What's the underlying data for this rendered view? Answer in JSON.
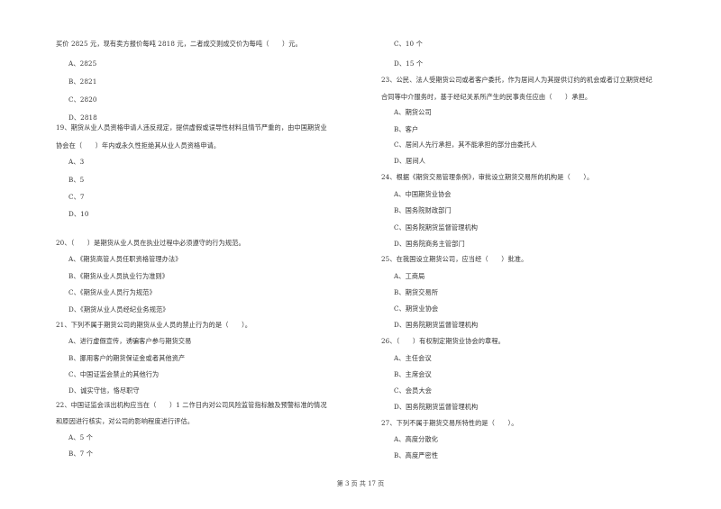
{
  "page": {
    "footer": "第 3 页 共 17 页"
  },
  "left": {
    "q18": {
      "stem_cont": "买价 2825 元，现有卖方报价每吨 2818 元，二者成交则成交价为每吨（　　）元。",
      "options": [
        "A、2825",
        "B、2821",
        "C、2820",
        "D、2818"
      ]
    },
    "q19": {
      "stem_line1": "19、期货从业人员资格申请人违反规定，提供虚假或误导性材料且情节严重的，由中国期货业",
      "stem_line2": "协会在（　　）年内或永久性拒绝其从业人员资格申请。",
      "options": [
        "A、3",
        "B、5",
        "C、7",
        "D、10"
      ]
    },
    "q20": {
      "stem": "20、（　　）是期货从业人员在执业过程中必须遵守的行为规范。",
      "options": [
        "A、《期货高管人员任职资格管理办法》",
        "B、《期货从业人员执业行为准则》",
        "C、《期货从业人员行为规范》",
        "D、《期货从业人员经纪业务规范》"
      ]
    },
    "q21": {
      "stem": "21、下列不属于期货公司的期货从业人员的禁止行为的是（　　）。",
      "options": [
        "A、进行虚假宣传，诱骗客户参与期货交易",
        "B、挪用客户的期货保证金或者其他资产",
        "C、中国证监会禁止的其他行为",
        "D、诚实守信，恪尽职守"
      ]
    },
    "q22": {
      "stem_line1": "22、中国证监会派出机构应当在（　　）1 二作日内对公司风险监管指标触及预警标准的情况",
      "stem_line2": "和原因进行核实，对公司的影响程度进行评估。",
      "options": [
        "A、5 个",
        "B、7 个"
      ]
    }
  },
  "right": {
    "q22_cont": {
      "options": [
        "C、10 个",
        "D、15 个"
      ]
    },
    "q23": {
      "stem_line1": "23、公民、法人受期货公司或者客户委托，作为居间人为其提供订约的机会或者订立期货经纪",
      "stem_line2": "合同等中介服务时，基于经纪关系所产生的民事责任应由（　　）承担。",
      "options": [
        "A、期货公司",
        "B、客户",
        "C、居间人先行承担，其不能承担的部分由委托人",
        "D、居间人"
      ]
    },
    "q24": {
      "stem": "24、根据《期货交易管理条例》，审批设立期货交易所的机构是（　　）。",
      "options": [
        "A、中国期货业协会",
        "B、国务院财政部门",
        "C、国务院期货监督管理机构",
        "D、国务院商务主管部门"
      ]
    },
    "q25": {
      "stem": "25、在我国设立期货公司，应当经（　　）批准。",
      "options": [
        "A、工商局",
        "B、期货交易所",
        "C、期货业协会",
        "D、国务院期货监督管理机构"
      ]
    },
    "q26": {
      "stem": "26、（　　）有权制定期货业协会的章程。",
      "options": [
        "A、主任会议",
        "B、主席会议",
        "C、会员大会",
        "D、国务院期货监督管理机构"
      ]
    },
    "q27": {
      "stem": "27、下列不属于期货交易所特性的是（　　）。",
      "options": [
        "A、高度分散化",
        "B、高度严密性"
      ]
    }
  }
}
